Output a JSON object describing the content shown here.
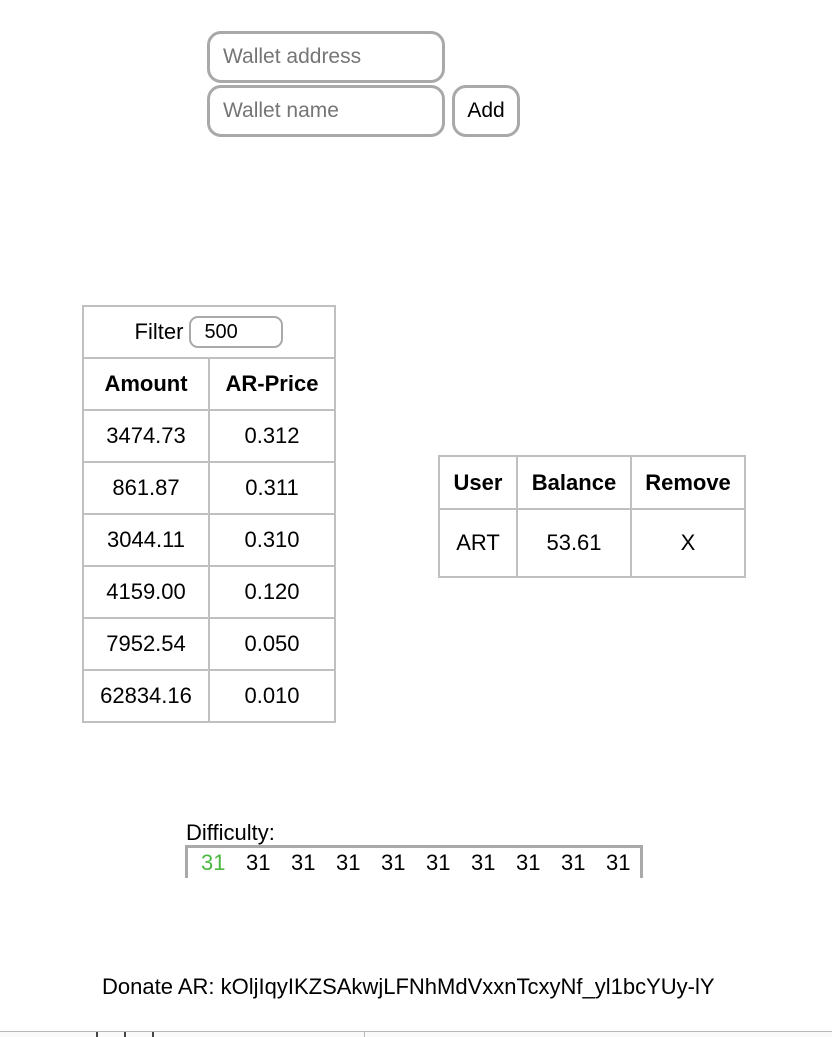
{
  "wallet_form": {
    "address_placeholder": "Wallet address",
    "name_placeholder": "Wallet name",
    "add_label": "Add"
  },
  "orders": {
    "filter_label": "Filter",
    "filter_value": "500",
    "columns": [
      "Amount",
      "AR-Price"
    ],
    "rows": [
      [
        "3474.73",
        "0.312"
      ],
      [
        "861.87",
        "0.311"
      ],
      [
        "3044.11",
        "0.310"
      ],
      [
        "4159.00",
        "0.120"
      ],
      [
        "7952.54",
        "0.050"
      ],
      [
        "62834.16",
        "0.010"
      ]
    ]
  },
  "wallets": {
    "columns": [
      "User",
      "Balance",
      "Remove"
    ],
    "rows": [
      {
        "user": "ART",
        "balance": "53.61",
        "remove": "X"
      }
    ]
  },
  "difficulty": {
    "label": "Difficulty:",
    "values": [
      "31",
      "31",
      "31",
      "31",
      "31",
      "31",
      "31",
      "31",
      "31",
      "31"
    ],
    "current_color": "#4cb843"
  },
  "donate": {
    "text": "Donate AR: kOljIqyIKZSAkwjLFNhMdVxxnTcxyNf_yl1bcYUy-lY"
  }
}
